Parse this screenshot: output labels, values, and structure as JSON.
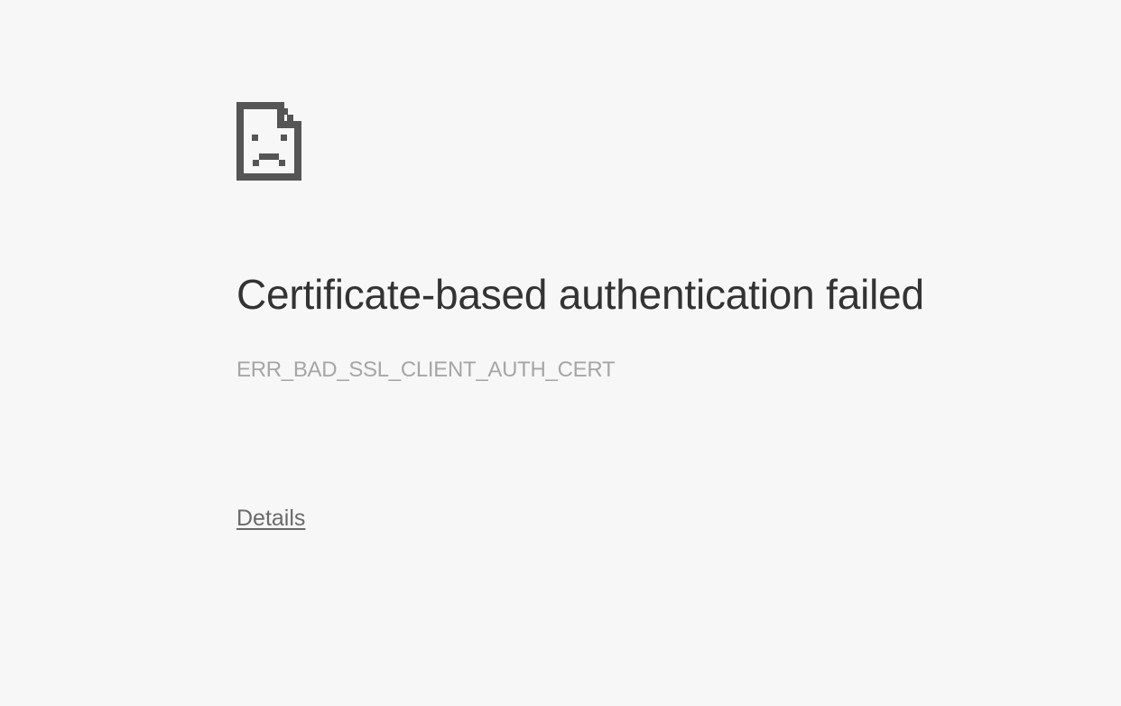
{
  "error": {
    "icon": "sad-page-icon",
    "title": "Certificate-based authentication failed",
    "code": "ERR_BAD_SSL_CLIENT_AUTH_CERT",
    "details_link": "Details"
  },
  "colors": {
    "background": "#f7f7f7",
    "icon": "#555555",
    "title": "#333333",
    "code": "#a6a6a6",
    "link": "#6a6a6a"
  }
}
